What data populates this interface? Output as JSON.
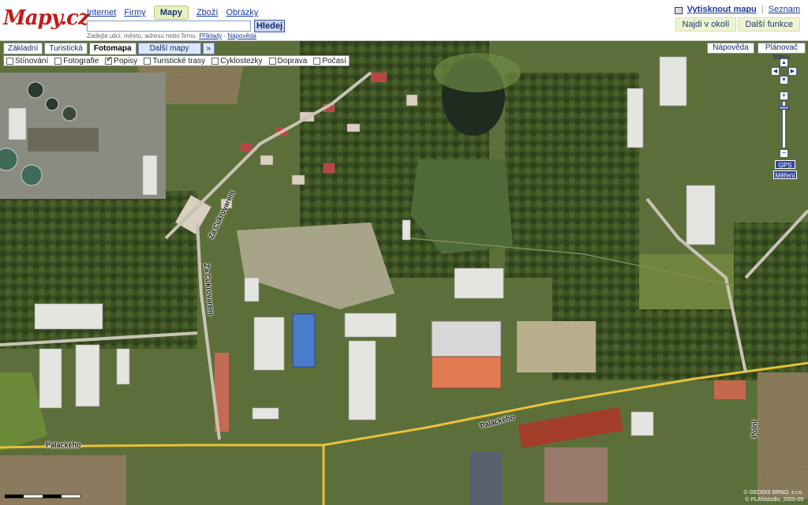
{
  "header": {
    "logo": {
      "main": "Mapy",
      "tld": ".cz"
    },
    "nav": [
      {
        "label": "Internet",
        "active": false
      },
      {
        "label": "Firmy",
        "active": false
      },
      {
        "label": "Mapy",
        "active": true
      },
      {
        "label": "Zboží",
        "active": false
      },
      {
        "label": "Obrázky",
        "active": false
      }
    ],
    "search": {
      "value": "",
      "button_label": "Hledej",
      "hint": "Zadejte ulici, město, adresu nebo firmu.",
      "examples_link": "Příklady",
      "help_link": "Nápověda",
      "link_separator": "-"
    },
    "top_right": {
      "print_label": "Vytisknout mapu",
      "list_label": "Seznam",
      "separator": "|",
      "sub_buttons": [
        "Najdi v okolí",
        "Další funkce"
      ]
    }
  },
  "map": {
    "tabs": [
      {
        "label": "Základní",
        "active": false
      },
      {
        "label": "Turistická",
        "active": false
      },
      {
        "label": "Fotomapa",
        "active": true
      },
      {
        "label": "Další mapy",
        "active": false,
        "dropdown": true
      }
    ],
    "dropdown_arrow": "»",
    "layers": [
      {
        "label": "Stínování",
        "checked": false
      },
      {
        "label": "Fotografie",
        "checked": false
      },
      {
        "label": "Popisy",
        "checked": true
      },
      {
        "label": "Turistické trasy",
        "checked": false
      },
      {
        "label": "Cyklostezky",
        "checked": false
      },
      {
        "label": "Doprava",
        "checked": false
      },
      {
        "label": "Počasí",
        "checked": false
      }
    ],
    "right_buttons": {
      "help": "Nápověda",
      "route": "Plánovač trasy"
    },
    "controls": {
      "zoom_in": "+",
      "zoom_out": "−",
      "pan": {
        "up": "▲",
        "down": "▼",
        "left": "◀",
        "right": "▶"
      },
      "gps": "GPS",
      "measure": "Měření"
    },
    "street_labels": [
      {
        "id": "za-cukrovarem-1",
        "text": "Za Cukrovarem"
      },
      {
        "id": "za-cukrovarem-2",
        "text": "Za Cukrovarem"
      },
      {
        "id": "palackeho-1",
        "text": "Palackého"
      },
      {
        "id": "palackeho-2",
        "text": "Palackého"
      },
      {
        "id": "polni",
        "text": "Polní"
      }
    ],
    "copyright": [
      "© GEODIS BRNO, s.r.o.",
      "© PLANstudio, 2005-09"
    ]
  },
  "colors": {
    "brand_red": "#c41a1a",
    "link_blue": "#1a3a9c",
    "road_yellow": "#e8c23a",
    "active_tab_bg": "#e8f0c0"
  }
}
